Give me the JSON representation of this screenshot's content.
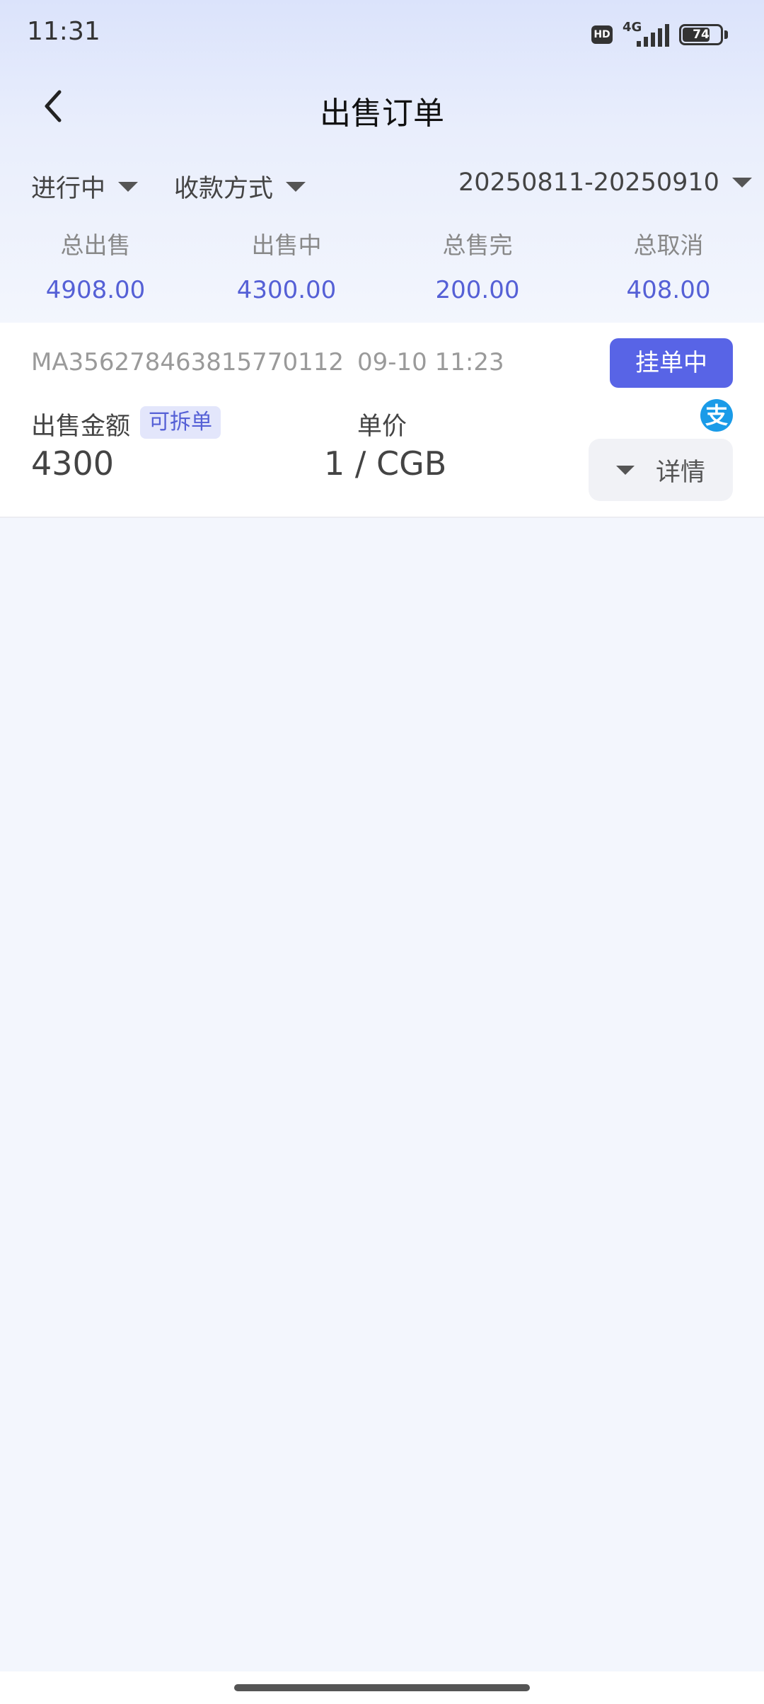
{
  "status_bar": {
    "time": "11:31",
    "hd": "HD",
    "network": "4G",
    "battery": "74",
    "battery_percent": 74
  },
  "header": {
    "title": "出售订单"
  },
  "filters": {
    "status": "进行中",
    "payment_method": "收款方式",
    "date_range": "20250811-20250910"
  },
  "stats": [
    {
      "label": "总出售",
      "value": "4908.00"
    },
    {
      "label": "出售中",
      "value": "4300.00"
    },
    {
      "label": "总售完",
      "value": "200.00"
    },
    {
      "label": "总取消",
      "value": "408.00"
    }
  ],
  "orders": [
    {
      "order_id": "MA356278463815770112",
      "time": "09-10 11:23",
      "status": "挂单中",
      "payment_icon": "支",
      "amount_label": "出售金额",
      "split_badge": "可拆单",
      "amount": "4300",
      "price_label": "单价",
      "price": "1 / CGB",
      "detail_label": "详情"
    }
  ],
  "colors": {
    "accent": "#5864e6",
    "stat_value": "#5560d6",
    "alipay": "#1a9be8",
    "background": "#f3f6fd"
  }
}
